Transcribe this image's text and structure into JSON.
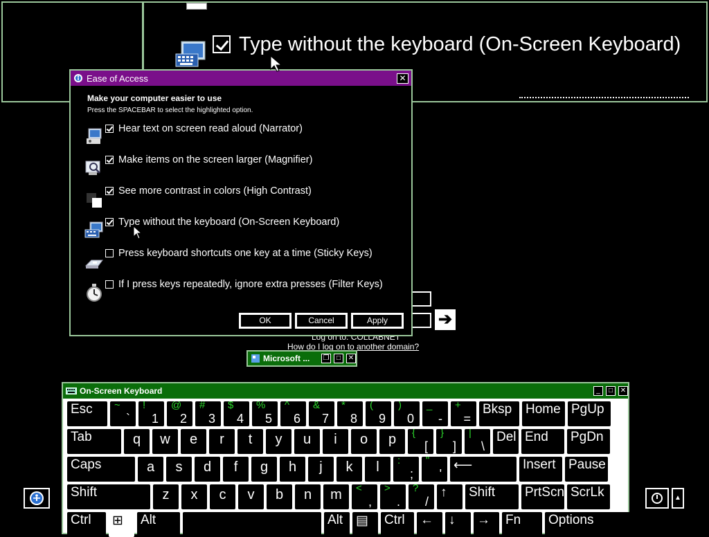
{
  "background": {
    "option_text": "Type without the keyboard (On-Screen Keyboard)",
    "icon": "on-screen-keyboard-icon"
  },
  "logon": {
    "domain_text": "Log on to: COLLABNET",
    "other_domain_link": "How do I log on to another domain?",
    "submit_icon": "right-arrow-icon"
  },
  "minimized_window": {
    "title": "Microsoft ..."
  },
  "dialog": {
    "title": "Ease of Access",
    "heading": "Make your computer easier to use",
    "hint": "Press the SPACEBAR to select the highlighted option.",
    "options": [
      {
        "label": "Hear text on screen read aloud (Narrator)",
        "checked": true,
        "icon": "narrator-icon"
      },
      {
        "label": "Make items on the screen larger (Magnifier)",
        "checked": true,
        "icon": "magnifier-icon"
      },
      {
        "label": "See more contrast in colors (High Contrast)",
        "checked": true,
        "icon": "high-contrast-icon"
      },
      {
        "label": "Type without the keyboard (On-Screen Keyboard)",
        "checked": true,
        "icon": "on-screen-keyboard-icon"
      },
      {
        "label": "Press keyboard shortcuts one key at a time (Sticky Keys)",
        "checked": false,
        "icon": "sticky-keys-icon"
      },
      {
        "label": "If I press keys repeatedly, ignore extra presses (Filter Keys)",
        "checked": false,
        "icon": "filter-keys-icon"
      }
    ],
    "buttons": {
      "ok": "OK",
      "cancel": "Cancel",
      "apply": "Apply"
    }
  },
  "osk": {
    "title": "On-Screen Keyboard",
    "rows": [
      [
        {
          "main": "Esc"
        },
        {
          "up": "~",
          "lo": "`"
        },
        {
          "up": "!",
          "lo": "1"
        },
        {
          "up": "@",
          "lo": "2"
        },
        {
          "up": "#",
          "lo": "3"
        },
        {
          "up": "$",
          "lo": "4"
        },
        {
          "up": "%",
          "lo": "5"
        },
        {
          "up": "^",
          "lo": "6"
        },
        {
          "up": "&",
          "lo": "7"
        },
        {
          "up": "*",
          "lo": "8"
        },
        {
          "up": "(",
          "lo": "9"
        },
        {
          "up": ")",
          "lo": "0"
        },
        {
          "up": "_",
          "lo": "-"
        },
        {
          "up": "+",
          "lo": "="
        },
        {
          "main": "Bksp"
        },
        {
          "main": "Home"
        },
        {
          "main": "PgUp"
        }
      ],
      [
        {
          "main": "Tab"
        },
        {
          "c": "q"
        },
        {
          "c": "w"
        },
        {
          "c": "e"
        },
        {
          "c": "r"
        },
        {
          "c": "t"
        },
        {
          "c": "y"
        },
        {
          "c": "u"
        },
        {
          "c": "i"
        },
        {
          "c": "o"
        },
        {
          "c": "p"
        },
        {
          "up": "{",
          "lo": "["
        },
        {
          "up": "}",
          "lo": "]"
        },
        {
          "up": "|",
          "lo": "\\"
        },
        {
          "main": "Del"
        },
        {
          "main": "End"
        },
        {
          "main": "PgDn"
        }
      ],
      [
        {
          "main": "Caps"
        },
        {
          "c": "a"
        },
        {
          "c": "s"
        },
        {
          "c": "d"
        },
        {
          "c": "f"
        },
        {
          "c": "g"
        },
        {
          "c": "h"
        },
        {
          "c": "j"
        },
        {
          "c": "k"
        },
        {
          "c": "l"
        },
        {
          "up": ":",
          "lo": ";"
        },
        {
          "up": "\"",
          "lo": "'"
        },
        {
          "main": "⟵"
        },
        {
          "main": "Insert"
        },
        {
          "main": "Pause"
        }
      ],
      [
        {
          "main": "Shift"
        },
        {
          "c": "z"
        },
        {
          "c": "x"
        },
        {
          "c": "c"
        },
        {
          "c": "v"
        },
        {
          "c": "b"
        },
        {
          "c": "n"
        },
        {
          "c": "m"
        },
        {
          "up": "<",
          "lo": ","
        },
        {
          "up": ">",
          "lo": "."
        },
        {
          "up": "?",
          "lo": "/"
        },
        {
          "main": "↑"
        },
        {
          "main": "Shift"
        },
        {
          "main": "PrtScn"
        },
        {
          "main": "ScrLk"
        }
      ],
      [
        {
          "main": "Ctrl"
        },
        {
          "main": "⊞"
        },
        {
          "main": "Alt"
        },
        {
          "main": ""
        },
        {
          "main": "Alt"
        },
        {
          "main": "▤"
        },
        {
          "main": "Ctrl"
        },
        {
          "main": "←"
        },
        {
          "main": "↓"
        },
        {
          "main": "→"
        },
        {
          "main": "Fn"
        },
        {
          "main": "Options"
        }
      ]
    ]
  },
  "corner": {
    "ease_icon": "ease-of-access-icon",
    "power_icon": "power-icon",
    "power_menu_arrow": "▲"
  }
}
